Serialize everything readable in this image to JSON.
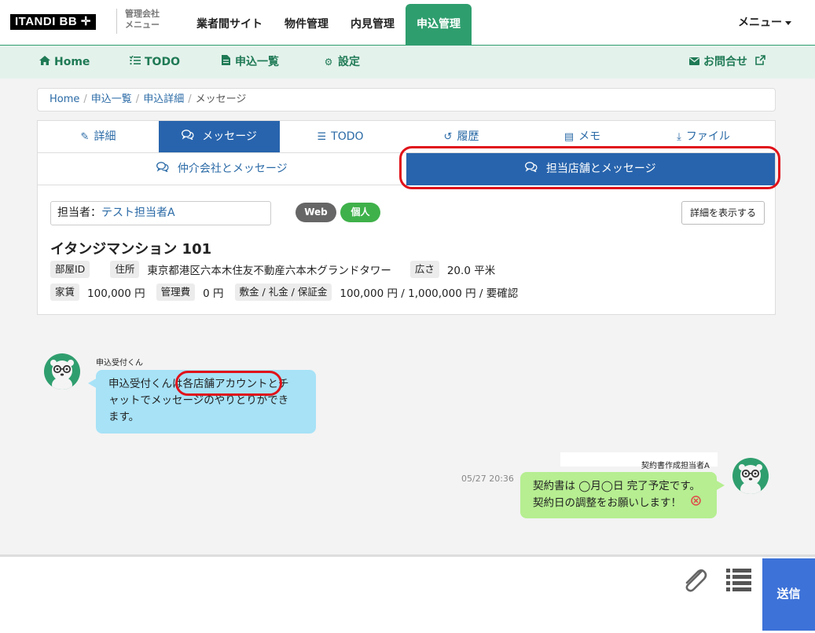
{
  "header": {
    "logo": "ITANDI BB ✛",
    "logo_sub_line1": "管理会社",
    "logo_sub_line2": "メニュー",
    "nav": [
      "業者間サイト",
      "物件管理",
      "内見管理",
      "申込管理"
    ],
    "active_nav": "申込管理",
    "menu_label": "メニュー"
  },
  "subnav": {
    "home": "Home",
    "todo": "TODO",
    "applications": "申込一覧",
    "settings": "設定",
    "contact": "お問合せ"
  },
  "breadcrumb": {
    "items": [
      "Home",
      "申込一覧",
      "申込詳細",
      "メッセージ"
    ]
  },
  "tabs": {
    "details": "詳細",
    "messages": "メッセージ",
    "todo": "TODO",
    "history": "履歴",
    "memo": "メモ",
    "files": "ファイル",
    "active": "メッセージ"
  },
  "subtabs": {
    "broker": "仲介会社とメッセージ",
    "store": "担当店舗とメッセージ",
    "active": "担当店舗とメッセージ"
  },
  "staff": {
    "label": "担当者：",
    "value": "テスト担当者A"
  },
  "badges": {
    "web": "Web",
    "personal": "個人",
    "web_color": "#666666",
    "personal_color": "#3fb14a"
  },
  "detail_button": "詳細を表示する",
  "property": {
    "name": "イタンジマンション 101",
    "room_id_label": "部屋ID",
    "address_label": "住所",
    "address": "東京都港区六本木住友不動産六本木グランドタワー",
    "area_label": "広さ",
    "area": "20.0 平米",
    "rent_label": "家賃",
    "rent": "100,000 円",
    "mgmt_label": "管理費",
    "mgmt": "0 円",
    "deposit_label": "敷金 / 礼金 / 保証金",
    "deposit": "100,000 円 / 1,000,000 円 / 要確認"
  },
  "messages": [
    {
      "sender": "申込受付くん",
      "lines": [
        "申込受付くんは各店舗アカウントとチ",
        "ャットでメッセージのやりとりができ",
        "ます。"
      ],
      "side": "left",
      "color": "#a7e2f7"
    },
    {
      "sender": "契約書作成担当者A",
      "timestamp": "05/27 20:36",
      "lines": [
        "契約書は ◯月◯日 完了予定です。",
        "契約日の調整をお願いします！"
      ],
      "side": "right",
      "color": "#b6ee91",
      "error_icon": "x-circle-icon"
    }
  ],
  "composer": {
    "send_label": "送信",
    "placeholder": ""
  },
  "colors": {
    "brand_green": "#2f9e6e",
    "active_blue": "#2864ad",
    "send_blue": "#3d72d8",
    "annotation_red": "#e0121a"
  }
}
